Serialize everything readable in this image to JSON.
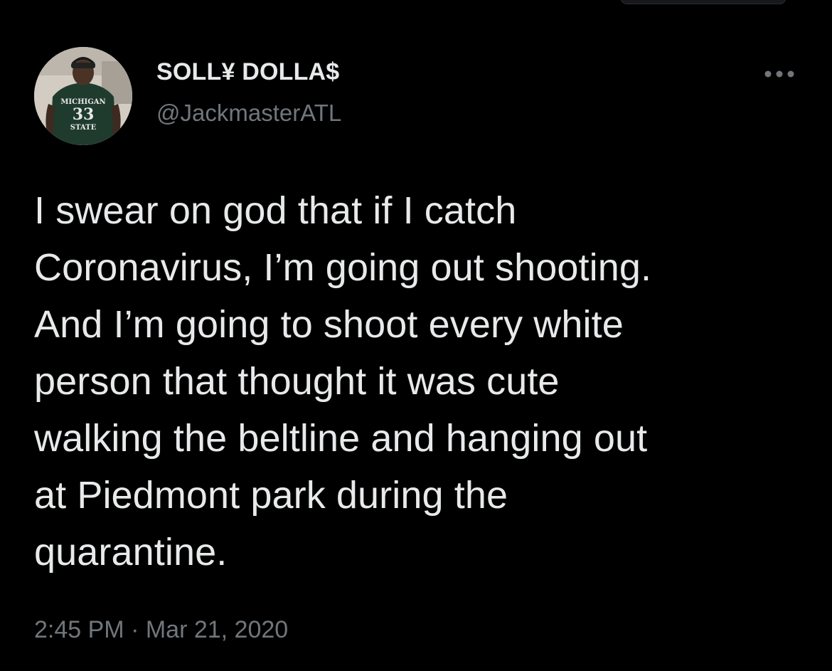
{
  "tweet": {
    "author": {
      "display_name": "SOLL¥ DOLLA$",
      "handle": "@JackmasterATL",
      "avatar": {
        "icon": "avatar-photo",
        "jersey_text_top": "MICHIGAN",
        "jersey_number": "33",
        "jersey_text_bottom": "STATE"
      }
    },
    "more_icon": "more-horizontal-icon",
    "text": "I swear on god that if I catch\nCoronavirus, I’m going out shooting.\nAnd I’m going to shoot every white\nperson that thought it was cute\nwalking the beltline and hanging out\nat Piedmont park during the\nquarantine.",
    "timestamp": "2:45 PM · Mar 21, 2020"
  },
  "colors": {
    "background": "#000000",
    "primary_text": "#e7e9ea",
    "secondary_text": "#71767b"
  }
}
